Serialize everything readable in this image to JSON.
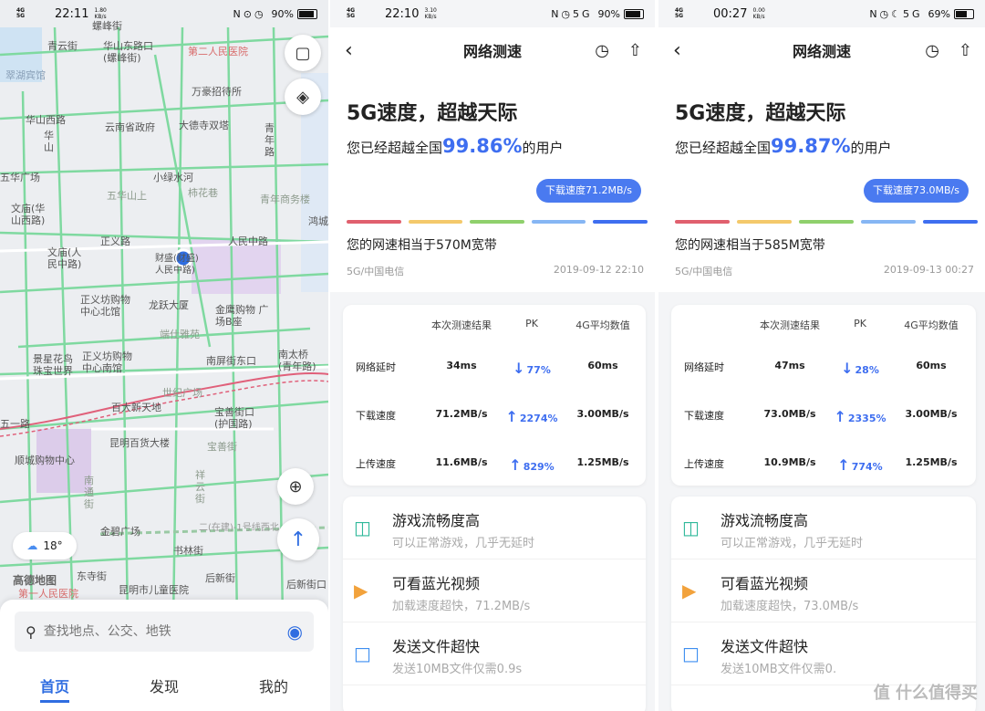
{
  "phone1": {
    "status": {
      "time": "22:11",
      "net": "1.80 KB/s",
      "battery": "90%"
    },
    "map_labels": [
      "青云街",
      "螺峰街",
      "华山东路口 (螺峰街)",
      "第二人民医院",
      "翠湖宾馆",
      "万豪招待所",
      "云南省政府",
      "大德寺双塔",
      "华山西路",
      "青年路",
      "华 山",
      "小绿水河",
      "五华广场",
      "柿花巷",
      "五华山上",
      "青年商务楼",
      "文庙(华 山西路)",
      "正义路",
      "鸿城",
      "人民中路",
      "文庙(人 民中路)",
      "财盛(财盛)人民中路)",
      "正义坊购物 中心北馆",
      "龙跃大厦",
      "金鹰购物 广场B座",
      "端仕雅苑",
      "景星花鸟 珠宝世界",
      "正义坊购物 中心南馆",
      "南屏街东口",
      "南太桥 (青年路)",
      "世纪广场",
      "百大新天地",
      "宝善街口 (护国路)",
      "五一路",
      "昆明百货大楼",
      "宝善街",
      "顺城购物中心",
      "南 通 街",
      "祥 云 街",
      "金碧广场",
      "书林街",
      "东寺街",
      "后新街",
      "后新街口",
      "第一人民医院",
      "昆明市儿童医院",
      "二(在建)-1号线西北"
    ],
    "weather": {
      "temp": "18°",
      "icon": "cloud-icon"
    },
    "map_logo": "高德地图",
    "search": {
      "placeholder": "查找地点、公交、地铁"
    },
    "tabs": [
      "首页",
      "发现",
      "我的"
    ]
  },
  "phone2": {
    "status": {
      "time": "22:10",
      "net": "3.10 KB/s",
      "battery": "90%"
    },
    "nav_title": "网络测速",
    "headline": "5G速度，超越天际",
    "beat_prefix": "您已经超越全国",
    "beat_pct": "99.86%",
    "beat_suffix": "的用户",
    "bubble": "下载速度71.2MB/s",
    "equiv": "您的网速相当于570M宽带",
    "carrier": "5G/中国电信",
    "datetime": "2019-09-12 22:10",
    "table": {
      "headers": [
        "本次测速结果",
        "PK",
        "4G平均数值"
      ],
      "rows": [
        {
          "label": "网络延时",
          "value": "34ms",
          "pk": "77%",
          "avg": "60ms",
          "dir": "↓"
        },
        {
          "label": "下载速度",
          "value": "71.2MB/s",
          "pk": "2274%",
          "avg": "3.00MB/s",
          "dir": "↑"
        },
        {
          "label": "上传速度",
          "value": "11.6MB/s",
          "pk": "829%",
          "avg": "1.25MB/s",
          "dir": "↑"
        }
      ]
    },
    "features": [
      {
        "title": "游戏流畅度高",
        "sub": "可以正常游戏，几乎无延时",
        "icon": "gamepad-icon"
      },
      {
        "title": "可看蓝光视频",
        "sub": "加载速度超快，71.2MB/s",
        "icon": "play-icon"
      },
      {
        "title": "发送文件超快",
        "sub": "发送10MB文件仅需0.9s",
        "icon": "folder-icon"
      }
    ]
  },
  "phone3": {
    "status": {
      "time": "00:27",
      "net": "0.00 KB/s",
      "battery": "69%"
    },
    "nav_title": "网络测速",
    "headline": "5G速度，超越天际",
    "beat_prefix": "您已经超越全国",
    "beat_pct": "99.87%",
    "beat_suffix": "的用户",
    "bubble": "下载速度73.0MB/s",
    "equiv": "您的网速相当于585M宽带",
    "carrier": "5G/中国电信",
    "datetime": "2019-09-13 00:27",
    "table": {
      "headers": [
        "本次测速结果",
        "PK",
        "4G平均数值"
      ],
      "rows": [
        {
          "label": "网络延时",
          "value": "47ms",
          "pk": "28%",
          "avg": "60ms",
          "dir": "↓"
        },
        {
          "label": "下载速度",
          "value": "73.0MB/s",
          "pk": "2335%",
          "avg": "3.00MB/s",
          "dir": "↑"
        },
        {
          "label": "上传速度",
          "value": "10.9MB/s",
          "pk": "774%",
          "avg": "1.25MB/s",
          "dir": "↑"
        }
      ]
    },
    "features": [
      {
        "title": "游戏流畅度高",
        "sub": "可以正常游戏，几乎无延时",
        "icon": "gamepad-icon"
      },
      {
        "title": "可看蓝光视频",
        "sub": "加载速度超快，73.0MB/s",
        "icon": "play-icon"
      },
      {
        "title": "发送文件超快",
        "sub": "发送10MB文件仅需0.",
        "icon": "folder-icon"
      }
    ],
    "watermark": "值 什么值得买"
  },
  "colors": {
    "accent": "#3e6ef0",
    "bars": [
      "#e0606e",
      "#f4c96b",
      "#8fd06c",
      "#86b6f4",
      "#3e6ef0"
    ]
  }
}
